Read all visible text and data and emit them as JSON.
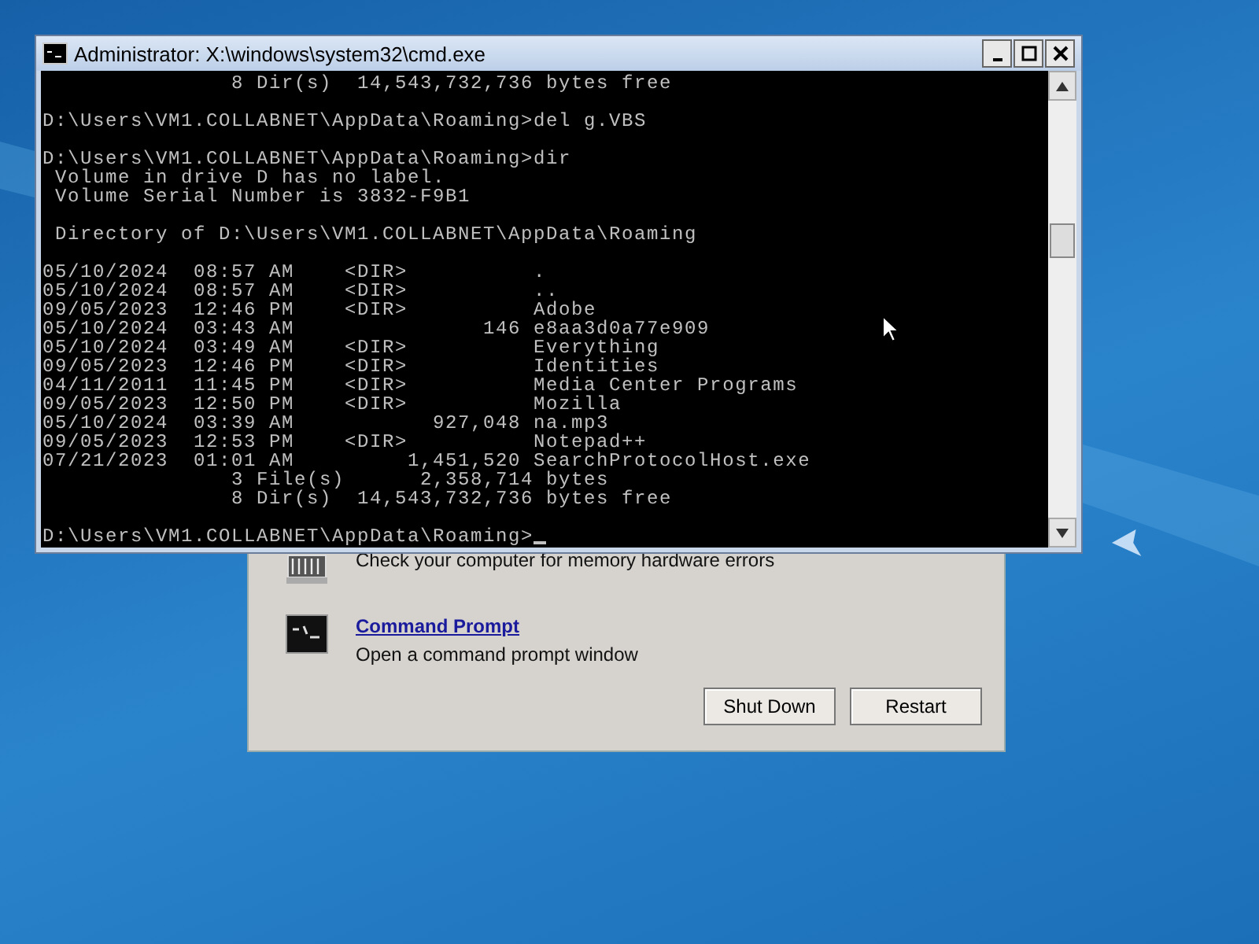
{
  "console_window": {
    "title": "Administrator: X:\\windows\\system32\\cmd.exe",
    "lines": [
      {
        "text": "               8 Dir(s)  14,543,732,736 bytes free",
        "blank_before": false
      },
      {
        "text": "D:\\Users\\VM1.COLLABNET\\AppData\\Roaming>del g.VBS",
        "blank_before": true
      },
      {
        "text": "D:\\Users\\VM1.COLLABNET\\AppData\\Roaming>dir",
        "blank_before": true
      },
      {
        "text": " Volume in drive D has no label.",
        "blank_before": false
      },
      {
        "text": " Volume Serial Number is 3832-F9B1",
        "blank_before": false
      },
      {
        "text": " Directory of D:\\Users\\VM1.COLLABNET\\AppData\\Roaming",
        "blank_before": true
      },
      {
        "text": "05/10/2024  08:57 AM    <DIR>          .",
        "blank_before": true
      },
      {
        "text": "05/10/2024  08:57 AM    <DIR>          ..",
        "blank_before": false
      },
      {
        "text": "09/05/2023  12:46 PM    <DIR>          Adobe",
        "blank_before": false
      },
      {
        "text": "05/10/2024  03:43 AM               146 e8aa3d0a77e909",
        "blank_before": false
      },
      {
        "text": "05/10/2024  03:49 AM    <DIR>          Everything",
        "blank_before": false
      },
      {
        "text": "09/05/2023  12:46 PM    <DIR>          Identities",
        "blank_before": false
      },
      {
        "text": "04/11/2011  11:45 PM    <DIR>          Media Center Programs",
        "blank_before": false
      },
      {
        "text": "09/05/2023  12:50 PM    <DIR>          Mozilla",
        "blank_before": false
      },
      {
        "text": "05/10/2024  03:39 AM           927,048 na.mp3",
        "blank_before": false
      },
      {
        "text": "09/05/2023  12:53 PM    <DIR>          Notepad++",
        "blank_before": false
      },
      {
        "text": "07/21/2023  01:01 AM         1,451,520 SearchProtocolHost.exe",
        "blank_before": false
      },
      {
        "text": "               3 File(s)      2,358,714 bytes",
        "blank_before": false
      },
      {
        "text": "               8 Dir(s)  14,543,732,736 bytes free",
        "blank_before": false
      },
      {
        "text": "D:\\Users\\VM1.COLLABNET\\AppData\\Roaming>",
        "blank_before": true
      }
    ]
  },
  "recovery_dialog": {
    "tools": [
      {
        "kind": "memory",
        "description": "Check your computer for memory hardware errors"
      },
      {
        "kind": "prompt",
        "title": "Command Prompt",
        "description": "Open a command prompt window"
      }
    ],
    "buttons": [
      "Shut Down",
      "Restart"
    ]
  }
}
